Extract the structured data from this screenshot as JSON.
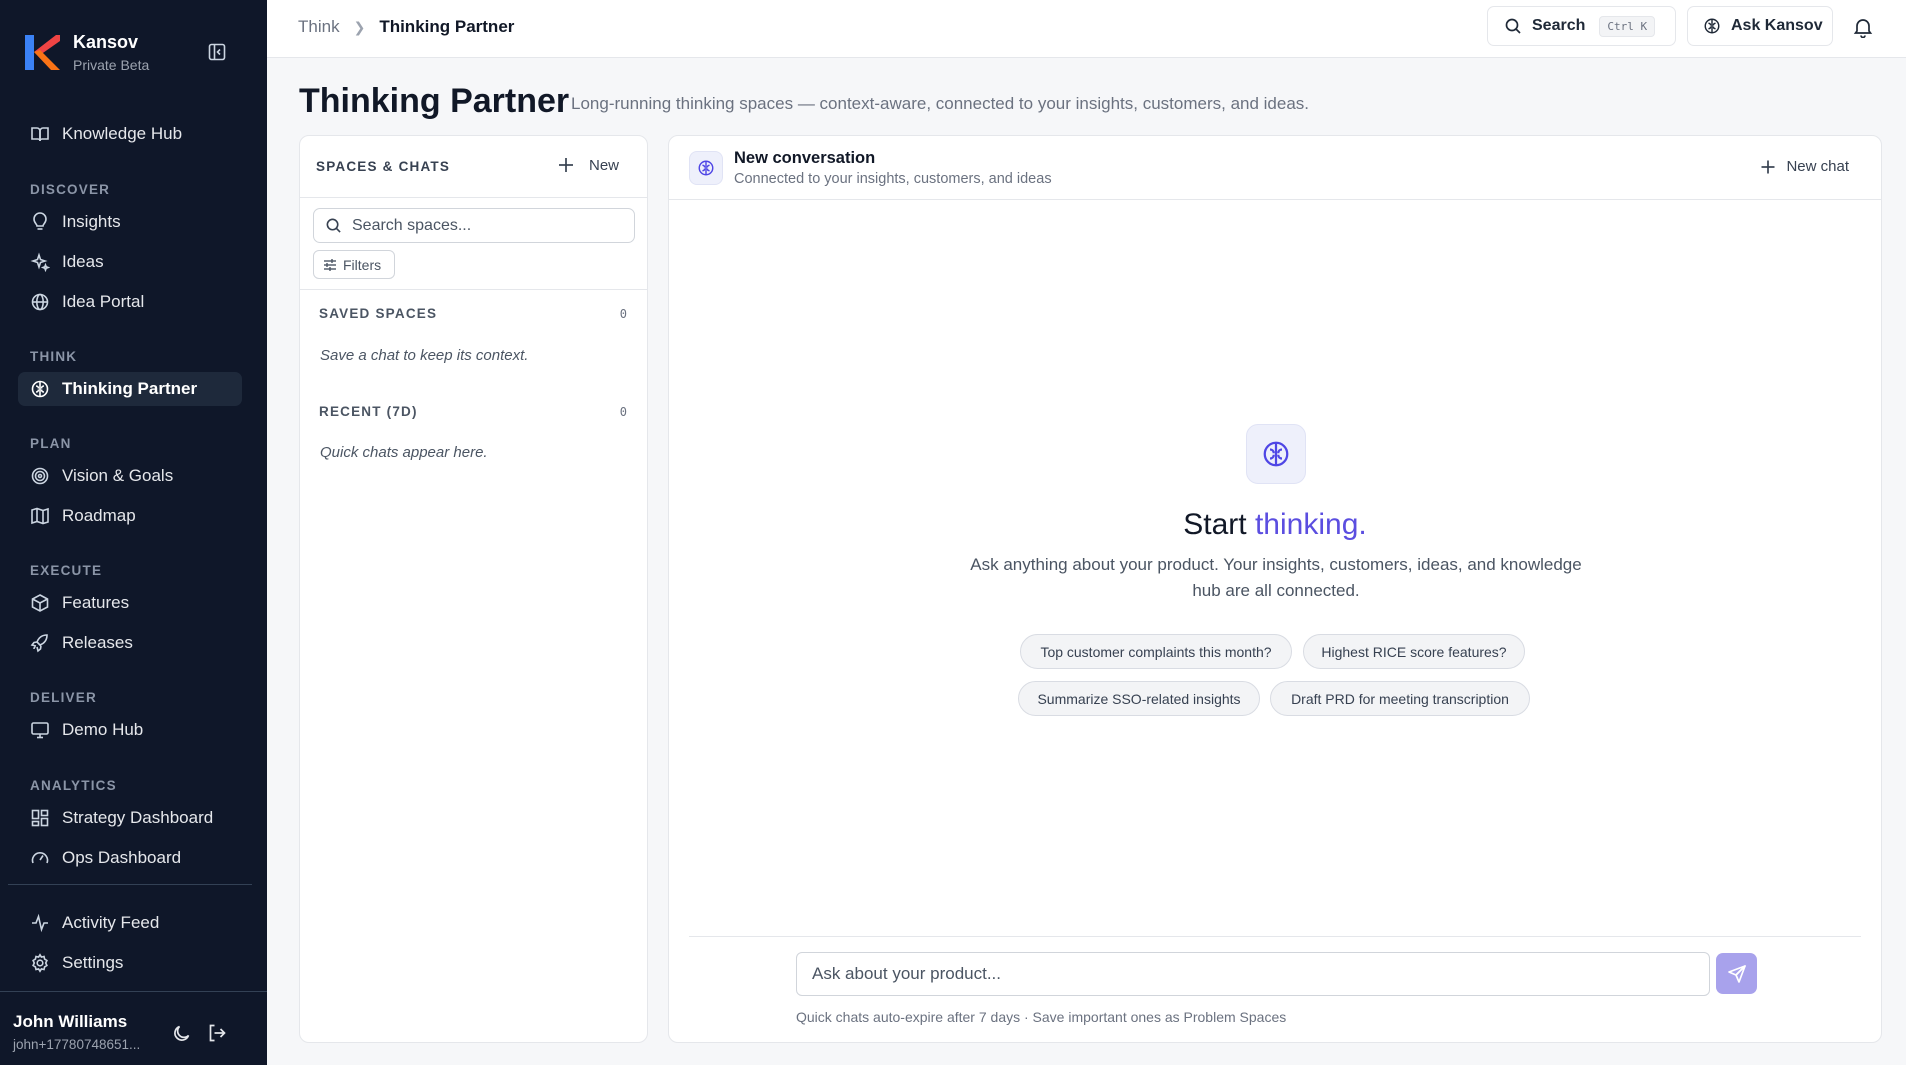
{
  "brand": {
    "name": "Kansov",
    "sub": "Private Beta"
  },
  "sidebar": {
    "knowledge_hub": "Knowledge Hub",
    "sections": {
      "discover": "DISCOVER",
      "think": "THINK",
      "plan": "PLAN",
      "execute": "EXECUTE",
      "deliver": "DELIVER",
      "analytics": "ANALYTICS"
    },
    "items": {
      "insights": "Insights",
      "ideas": "Ideas",
      "idea_portal": "Idea Portal",
      "thinking_partner": "Thinking Partner",
      "vision_goals": "Vision & Goals",
      "roadmap": "Roadmap",
      "features": "Features",
      "releases": "Releases",
      "demo_hub": "Demo Hub",
      "strategy_dashboard": "Strategy Dashboard",
      "ops_dashboard": "Ops Dashboard",
      "activity_feed": "Activity Feed",
      "settings": "Settings"
    },
    "user": {
      "name": "John Williams",
      "email": "john+17780748651..."
    }
  },
  "topbar": {
    "breadcrumb": {
      "parent": "Think",
      "current": "Thinking Partner"
    },
    "search_label": "Search",
    "search_shortcut": "Ctrl K",
    "ask_label": "Ask Kansov"
  },
  "page": {
    "title": "Thinking Partner",
    "subtitle": "Long-running thinking spaces — context-aware, connected to your insights, customers, and ideas."
  },
  "spaces": {
    "title": "SPACES & CHATS",
    "new_label": "New",
    "search_placeholder": "Search spaces...",
    "filters_label": "Filters",
    "saved": {
      "title": "SAVED SPACES",
      "count": "0",
      "empty": "Save a chat to keep its context."
    },
    "recent": {
      "title": "RECENT (7D)",
      "count": "0",
      "empty": "Quick chats appear here."
    }
  },
  "chat": {
    "title": "New conversation",
    "subtitle": "Connected to your insights, customers, and ideas",
    "new_chat_label": "New chat",
    "empty": {
      "title_start": "Start ",
      "title_accent": "thinking.",
      "description": "Ask anything about your product. Your insights, customers, ideas, and knowledge hub are all connected."
    },
    "suggestions": [
      "Top customer complaints this month?",
      "Highest RICE score features?",
      "Summarize SSO-related insights",
      "Draft PRD for meeting transcription"
    ],
    "composer_placeholder": "Ask about your product...",
    "composer_note": "Quick chats auto-expire after 7 days · Save important ones as Problem Spaces"
  },
  "colors": {
    "sidebar_bg": "#0f1729",
    "accent": "#5b4ee0",
    "send_button": "#a8a2ec"
  }
}
